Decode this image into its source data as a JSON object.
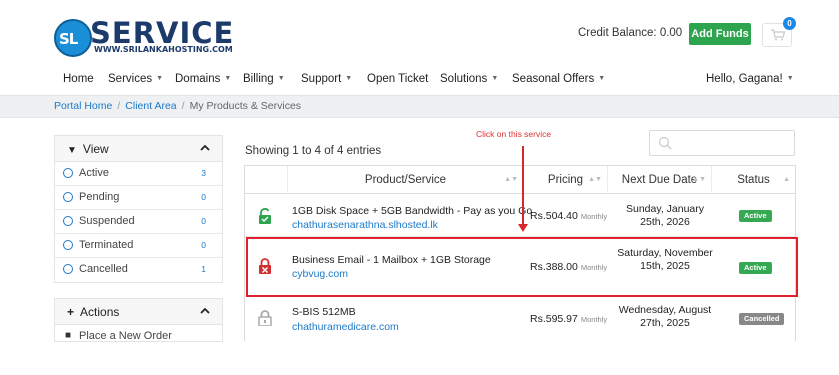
{
  "brand": {
    "logo_mark": "SL",
    "name": "SERVICE",
    "tagline": "WWW.SRILANKAHOSTING.COM"
  },
  "header": {
    "credit_balance": "Credit Balance: 0.00",
    "add_funds": "Add Funds",
    "cart_count": "0"
  },
  "nav": {
    "items": [
      {
        "label": "Home",
        "dropdown": false
      },
      {
        "label": "Services",
        "dropdown": true
      },
      {
        "label": "Domains",
        "dropdown": true
      },
      {
        "label": "Billing",
        "dropdown": true
      },
      {
        "label": "Support",
        "dropdown": true
      },
      {
        "label": "Open Ticket",
        "dropdown": false
      },
      {
        "label": "Solutions",
        "dropdown": true
      },
      {
        "label": "Seasonal Offers",
        "dropdown": true
      }
    ],
    "user": "Hello, Gagana!"
  },
  "breadcrumb": {
    "items": [
      "Portal Home",
      "Client Area",
      "My Products & Services"
    ]
  },
  "sidebar": {
    "view": {
      "title": "View",
      "items": [
        {
          "label": "Active",
          "count": "3"
        },
        {
          "label": "Pending",
          "count": "0"
        },
        {
          "label": "Suspended",
          "count": "0"
        },
        {
          "label": "Terminated",
          "count": "0"
        },
        {
          "label": "Cancelled",
          "count": "1"
        }
      ]
    },
    "actions": {
      "title": "Actions",
      "first_item": "Place a New Order"
    }
  },
  "content": {
    "showing": "Showing 1 to 4 of 4 entries",
    "annotation": "Click on this service",
    "columns": [
      "Product/Service",
      "Pricing",
      "Next Due Date",
      "Status"
    ],
    "rows": [
      {
        "name": "1GB Disk Space + 5GB Bandwidth - Pay as you Go",
        "domain": "chathurasenarathna.slhosted.lk",
        "price": "Rs.504.40",
        "cycle": "Monthly",
        "due": "Sunday, January 25th, 2026",
        "status": "Active",
        "icon": "lock-open-icon"
      },
      {
        "name": "Business Email - 1 Mailbox + 1GB Storage",
        "domain": "cybvug.com",
        "price": "Rs.388.00",
        "cycle": "Monthly",
        "due": "Saturday, November 15th, 2025",
        "status": "Active",
        "icon": "lock-closed-icon"
      },
      {
        "name": "S-BIS 512MB",
        "domain": "chathuramedicare.com",
        "price": "Rs.595.97",
        "cycle": "Monthly",
        "due": "Wednesday, August 27th, 2025",
        "status": "Cancelled",
        "icon": "lock-grey-icon"
      }
    ]
  }
}
